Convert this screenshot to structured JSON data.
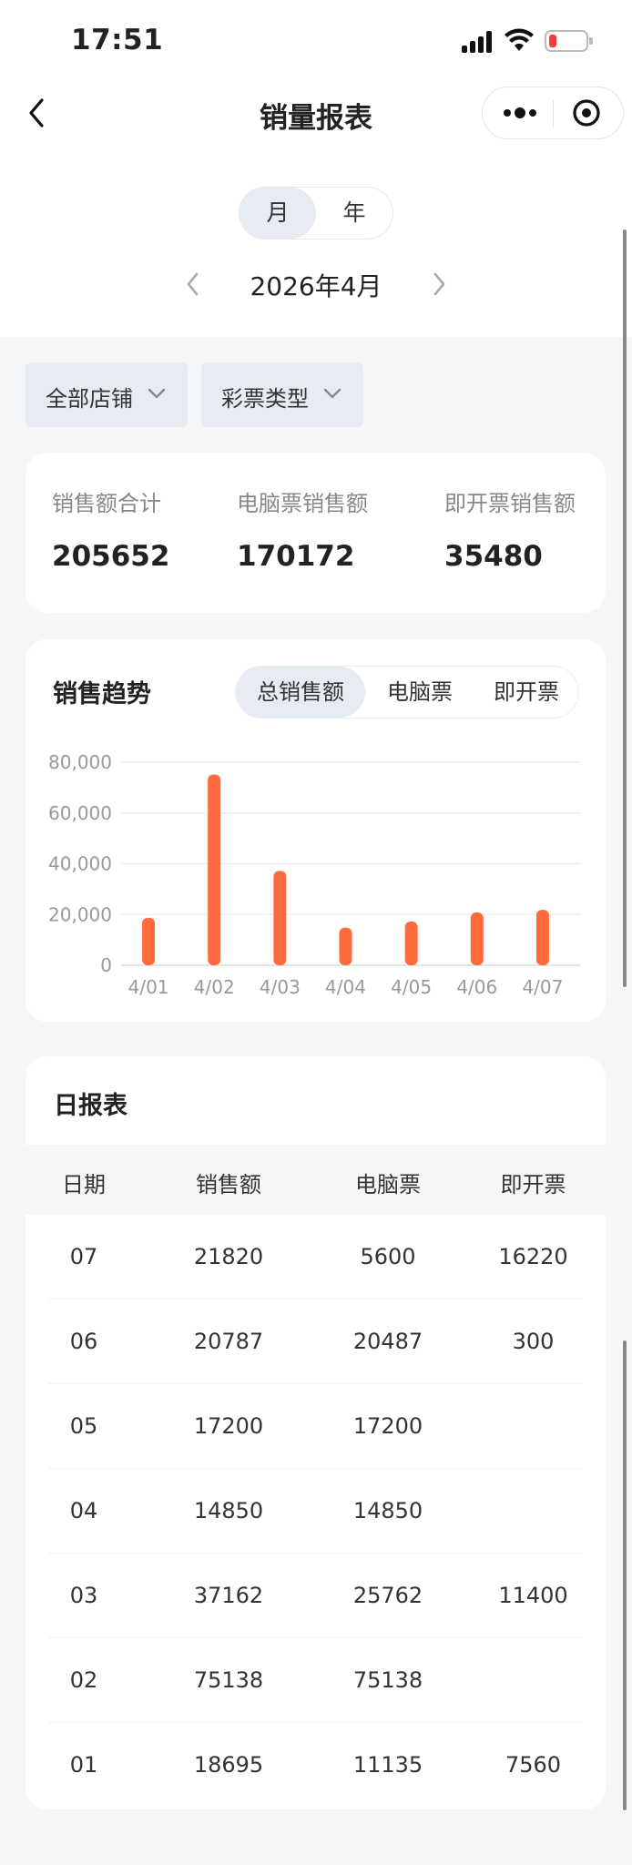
{
  "status_bar": {
    "time": "17:51"
  },
  "nav": {
    "title": "销量报表"
  },
  "period_toggle": {
    "options": [
      "月",
      "年"
    ],
    "selected": "月"
  },
  "month_picker": {
    "label": "2026年4月"
  },
  "filters": {
    "store": "全部店铺",
    "lottery_type": "彩票类型"
  },
  "summary": {
    "items": [
      {
        "label": "销售额合计",
        "value": "205652"
      },
      {
        "label": "电脑票销售额",
        "value": "170172"
      },
      {
        "label": "即开票销售额",
        "value": "35480"
      }
    ]
  },
  "trend": {
    "title": "销售趋势",
    "tabs": [
      "总销售额",
      "电脑票",
      "即开票"
    ],
    "selected_tab": "总销售额"
  },
  "chart_data": {
    "type": "bar",
    "categories": [
      "4/01",
      "4/02",
      "4/03",
      "4/04",
      "4/05",
      "4/06",
      "4/07"
    ],
    "values": [
      18695,
      75138,
      37162,
      14850,
      17200,
      20787,
      21820
    ],
    "ylim": [
      0,
      80000
    ],
    "yticks": [
      "0",
      "20,000",
      "40,000",
      "60,000",
      "80,000"
    ],
    "ytick_values": [
      0,
      20000,
      40000,
      60000,
      80000
    ],
    "grid": true,
    "bar_color": "#ff6a3d"
  },
  "daily_report": {
    "title": "日报表",
    "columns": [
      "日期",
      "销售额",
      "电脑票",
      "即开票"
    ],
    "rows": [
      [
        "07",
        "21820",
        "5600",
        "16220"
      ],
      [
        "06",
        "20787",
        "20487",
        "300"
      ],
      [
        "05",
        "17200",
        "17200",
        ""
      ],
      [
        "04",
        "14850",
        "14850",
        ""
      ],
      [
        "03",
        "37162",
        "25762",
        "11400"
      ],
      [
        "02",
        "75138",
        "75138",
        ""
      ],
      [
        "01",
        "18695",
        "11135",
        "7560"
      ]
    ]
  },
  "colors": {
    "accent": "#ff6a3d",
    "segment_bg": "#e7ebf2",
    "page_bg": "#f5f6f8"
  }
}
